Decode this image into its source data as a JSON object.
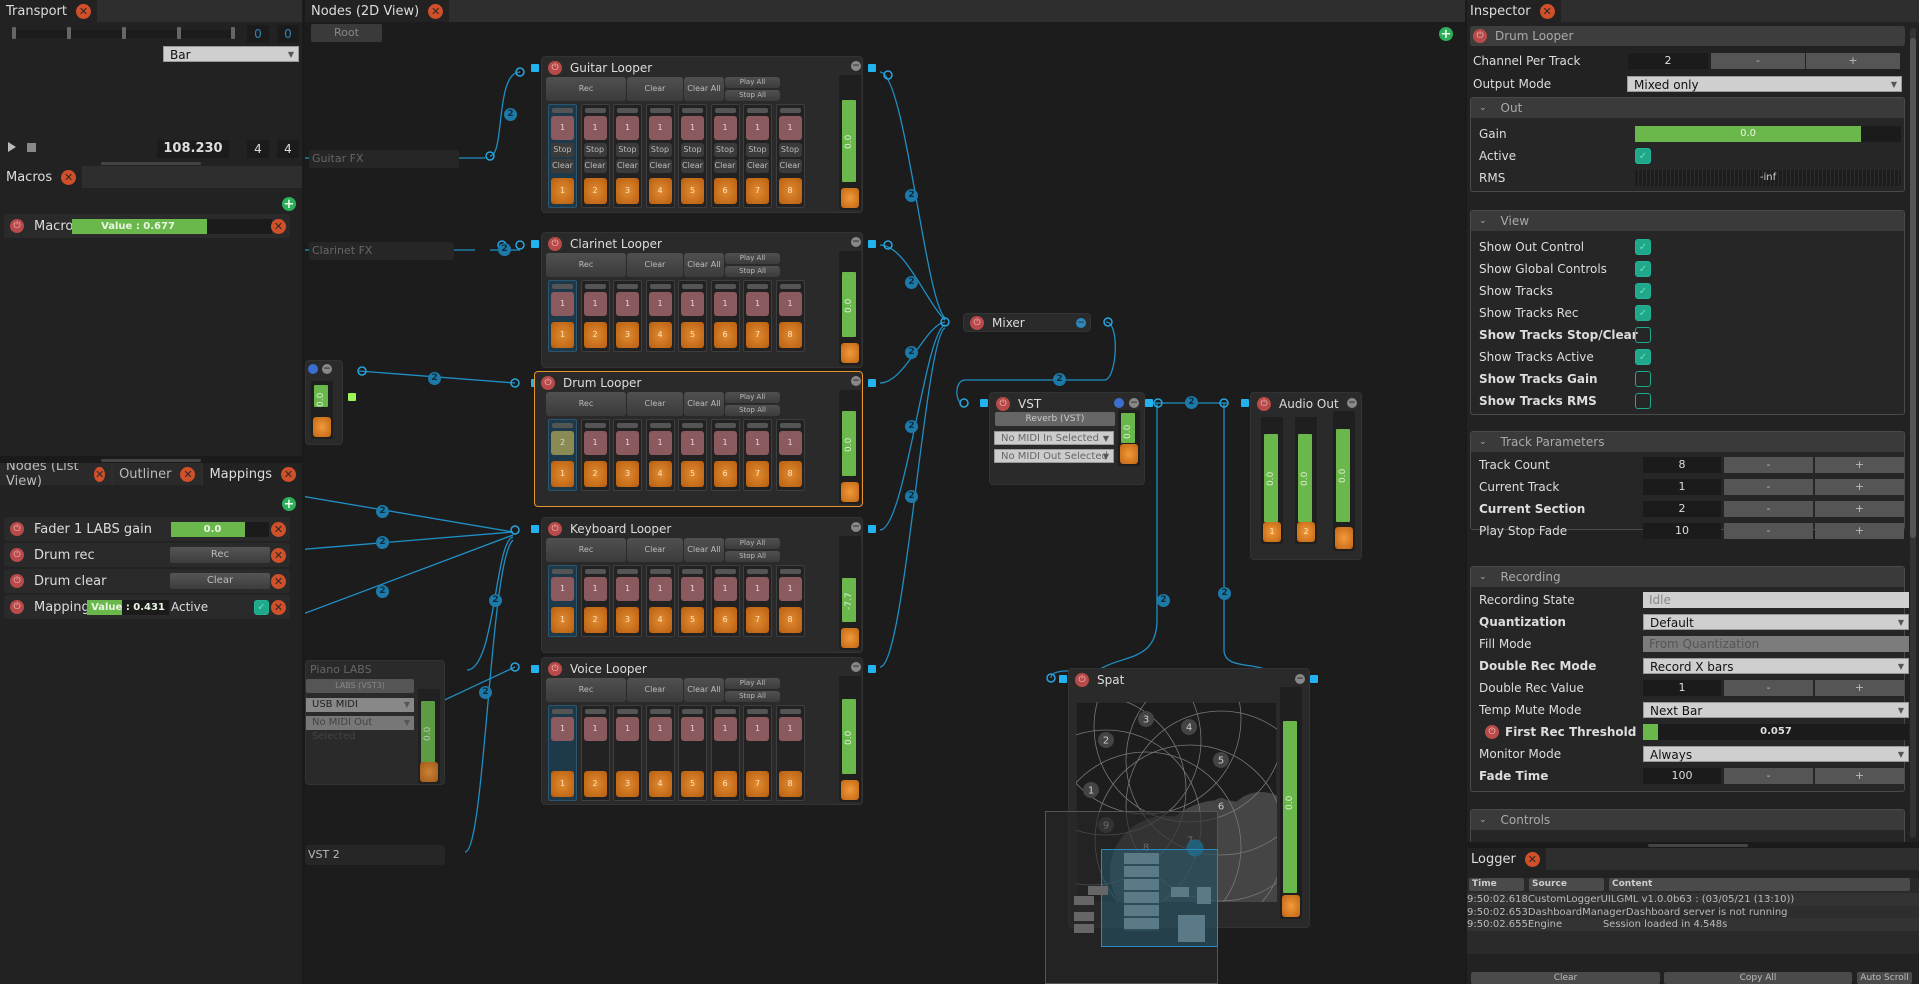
{
  "transport": {
    "tab_label": "Transport",
    "position_values": [
      "0",
      "0"
    ],
    "quantization": "Bar",
    "bpm": "108.230",
    "beats_per_bar": "4",
    "beat_unit": "4",
    "play_icon": "play-icon",
    "stop_icon": "stop-icon"
  },
  "macros": {
    "tab_label": "Macros",
    "items": [
      {
        "name": "Macro",
        "value_label": "Value : 0.677",
        "value": 0.677
      }
    ]
  },
  "left_bottom": {
    "tabs": [
      {
        "label": "Nodes (List View)",
        "active": false
      },
      {
        "label": "Outliner",
        "active": false
      },
      {
        "label": "Mappings",
        "active": true
      }
    ],
    "mappings": [
      {
        "name": "Fader 1 LABS gain",
        "control": "slider",
        "value_label": "0.0",
        "value": 0.75
      },
      {
        "name": "Drum rec",
        "control": "button",
        "button_label": "Rec"
      },
      {
        "name": "Drum clear",
        "control": "button",
        "button_label": "Clear"
      },
      {
        "name": "Mapping",
        "control": "value",
        "value_label": "Value : 0.431",
        "value": 0.431,
        "active_label": "Active",
        "active": true
      }
    ]
  },
  "nodes_view": {
    "tab_label": "Nodes (2D View)",
    "breadcrumb": "Root",
    "connection_channels": "2",
    "loopers": [
      {
        "name": "Guitar Looper",
        "rec": "Rec",
        "clear": "Clear",
        "clear_all": "Clear All",
        "play_all": "Play All",
        "stop_all": "Stop All",
        "gain_label": "0.0",
        "gain": 0.8,
        "show_stop_clear": true,
        "rec_values": [
          "1",
          "1",
          "1",
          "1",
          "1",
          "1",
          "1",
          "1"
        ],
        "play_values": [
          "1",
          "2",
          "3",
          "4",
          "5",
          "6",
          "7",
          "8"
        ],
        "stop_label": "Stop",
        "clear_label": "Clear"
      },
      {
        "name": "Clarinet Looper",
        "rec": "Rec",
        "clear": "Clear",
        "clear_all": "Clear All",
        "play_all": "Play All",
        "stop_all": "Stop All",
        "gain_label": "0.0",
        "gain": 0.8,
        "show_stop_clear": false,
        "rec_values": [
          "1",
          "1",
          "1",
          "1",
          "1",
          "1",
          "1",
          "1"
        ],
        "play_values": [
          "1",
          "2",
          "3",
          "4",
          "5",
          "6",
          "7",
          "8"
        ]
      },
      {
        "name": "Drum Looper",
        "selected": true,
        "rec": "Rec",
        "clear": "Clear",
        "clear_all": "Clear All",
        "play_all": "Play All",
        "stop_all": "Stop All",
        "gain_label": "0.0",
        "gain": 0.8,
        "show_stop_clear": false,
        "rec_values": [
          "2",
          "1",
          "1",
          "1",
          "1",
          "1",
          "1",
          "1"
        ],
        "play_values": [
          "1",
          "2",
          "3",
          "4",
          "5",
          "6",
          "7",
          "8"
        ]
      },
      {
        "name": "Keyboard Looper",
        "rec": "Rec",
        "clear": "Clear",
        "clear_all": "Clear All",
        "play_all": "Play All",
        "stop_all": "Stop All",
        "gain_label": "-7.7",
        "gain": 0.55,
        "show_stop_clear": false,
        "rec_values": [
          "1",
          "1",
          "1",
          "1",
          "1",
          "1",
          "1",
          "1"
        ],
        "play_values": [
          "1",
          "2",
          "3",
          "4",
          "5",
          "6",
          "7",
          "8"
        ]
      },
      {
        "name": "Voice Looper",
        "rec": "Rec",
        "clear": "Clear",
        "clear_all": "Clear All",
        "play_all": "Play All",
        "stop_all": "Stop All",
        "gain_label": "0.0",
        "gain": 0.8,
        "show_stop_clear": false,
        "rec_values": [
          "1",
          "1",
          "1",
          "1",
          "1",
          "1",
          "1",
          "1"
        ],
        "play_values": [
          "1",
          "2",
          "3",
          "4",
          "5",
          "6",
          "7",
          "8"
        ]
      }
    ],
    "ghost_nodes": [
      "Guitar FX",
      "Clarinet FX",
      "Piano LABS",
      "VST 2"
    ],
    "piano_labs": {
      "plugin": "LABS (VST3)",
      "midi_in": "USB MIDI",
      "midi_out": "No MIDI Out Selected",
      "gain_label": "0.0"
    },
    "left_partial_gain": "0.0",
    "mixer": {
      "name": "Mixer"
    },
    "vst": {
      "name": "VST",
      "plugin": "Reverb (VST)",
      "midi_in": "No MIDI In Selected",
      "midi_out": "No MIDI Out Selected",
      "gain_label": "0.0"
    },
    "audio_out": {
      "name": "Audio Out",
      "channels": [
        "1",
        "2"
      ],
      "gain_labels": [
        "0.0",
        "0.0",
        "0.0"
      ]
    },
    "spat": {
      "name": "Spat",
      "points": [
        "1",
        "2",
        "3",
        "4",
        "5",
        "6",
        "7",
        "8",
        "9"
      ],
      "gain_label": "0.0"
    }
  },
  "inspector": {
    "tab_label": "Inspector",
    "node_name": "Drum Looper",
    "channel_per_track": {
      "label": "Channel Per Track",
      "value": "2"
    },
    "output_mode": {
      "label": "Output Mode",
      "value": "Mixed only"
    },
    "out": {
      "title": "Out",
      "gain": {
        "label": "Gain",
        "value_label": "0.0",
        "value": 0.85
      },
      "active": {
        "label": "Active",
        "checked": true
      },
      "rms": {
        "label": "RMS",
        "value_label": "-inf"
      }
    },
    "view": {
      "title": "View",
      "items": [
        {
          "label": "Show Out Control",
          "checked": true,
          "bold": false
        },
        {
          "label": "Show Global Controls",
          "checked": true,
          "bold": false
        },
        {
          "label": "Show Tracks",
          "checked": true,
          "bold": false
        },
        {
          "label": "Show Tracks Rec",
          "checked": true,
          "bold": false
        },
        {
          "label": "Show Tracks Stop/Clear",
          "checked": false,
          "bold": true
        },
        {
          "label": "Show Tracks Active",
          "checked": true,
          "bold": false
        },
        {
          "label": "Show Tracks Gain",
          "checked": false,
          "bold": true
        },
        {
          "label": "Show Tracks RMS",
          "checked": false,
          "bold": true
        }
      ]
    },
    "track_parameters": {
      "title": "Track Parameters",
      "items": [
        {
          "label": "Track Count",
          "value": "8",
          "bold": false
        },
        {
          "label": "Current Track",
          "value": "1",
          "bold": false
        },
        {
          "label": "Current Section",
          "value": "2",
          "bold": true
        },
        {
          "label": "Play Stop Fade",
          "value": "10",
          "bold": false
        }
      ],
      "minus": "-",
      "plus": "+"
    },
    "recording": {
      "title": "Recording",
      "recording_state": {
        "label": "Recording State",
        "value": "Idle"
      },
      "quantization": {
        "label": "Quantization",
        "value": "Default"
      },
      "fill_mode": {
        "label": "Fill Mode",
        "value": "From Quantization"
      },
      "double_rec_mode": {
        "label": "Double Rec Mode",
        "value": "Record X bars"
      },
      "double_rec_value": {
        "label": "Double Rec Value",
        "value": "1"
      },
      "temp_mute_mode": {
        "label": "Temp Mute Mode",
        "value": "Next Bar"
      },
      "first_rec_threshold": {
        "label": "First Rec Threshold",
        "value_label": "0.057",
        "value": 0.057
      },
      "monitor_mode": {
        "label": "Monitor Mode",
        "value": "Always"
      },
      "fade_time": {
        "label": "Fade Time",
        "value": "100"
      }
    },
    "controls": {
      "title": "Controls"
    }
  },
  "logger": {
    "tab_label": "Logger",
    "columns": [
      "Time",
      "Source",
      "Content"
    ],
    "rows": [
      {
        "time": "9:50:02.618",
        "source": "CustomLoggerUI",
        "content": "LGML v1.0.0b63 : (03/05/21 (13:10))"
      },
      {
        "time": "9:50:02.653",
        "source": "DashboardManager",
        "content": "Dashboard server is not running"
      },
      {
        "time": "9:50:02.655",
        "source": "Engine",
        "content": "Session loaded in 4.548s"
      }
    ],
    "buttons": {
      "clear": "Clear",
      "copy_all": "Copy All",
      "auto_scroll": "Auto Scroll"
    }
  }
}
